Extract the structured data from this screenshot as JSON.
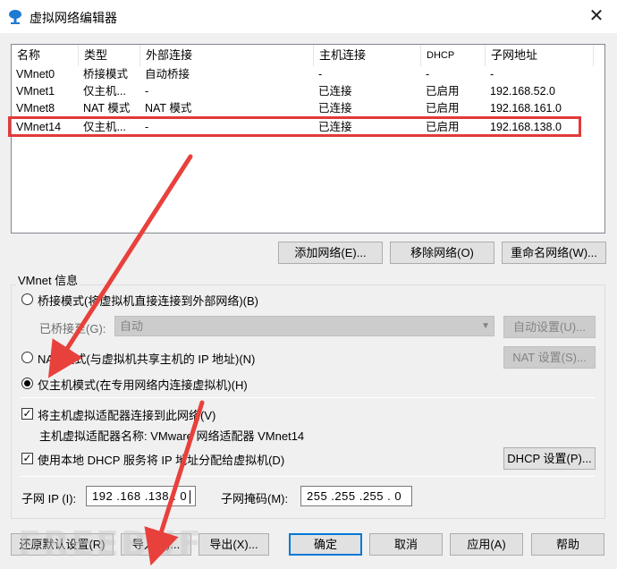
{
  "window": {
    "title": "虚拟网络编辑器",
    "close_glyph": "✕"
  },
  "network_list": {
    "columns": [
      "名称",
      "类型",
      "外部连接",
      "主机连接",
      "DHCP",
      "子网地址"
    ],
    "rows": [
      {
        "name": "VMnet0",
        "type": "桥接模式",
        "external": "自动桥接",
        "host": "-",
        "dhcp": "-",
        "subnet": "-"
      },
      {
        "name": "VMnet1",
        "type": "仅主机...",
        "external": "-",
        "host": "已连接",
        "dhcp": "已启用",
        "subnet": "192.168.52.0"
      },
      {
        "name": "VMnet8",
        "type": "NAT 模式",
        "external": "NAT 模式",
        "host": "已连接",
        "dhcp": "已启用",
        "subnet": "192.168.161.0"
      },
      {
        "name": "VMnet14",
        "type": "仅主机...",
        "external": "-",
        "host": "已连接",
        "dhcp": "已启用",
        "subnet": "192.168.138.0"
      }
    ],
    "selected_row": 3
  },
  "list_buttons": {
    "add": "添加网络(E)...",
    "remove": "移除网络(O)",
    "rename": "重命名网络(W)..."
  },
  "vmnet_info": {
    "group_label": "VMnet 信息",
    "bridged_radio": "桥接模式(将虚拟机直接连接到外部网络)(B)",
    "bridged_to_label": "已桥接至(G):",
    "bridged_to_value": "自动",
    "auto_settings": "自动设置(U)...",
    "nat_radio": "NAT 模式(与虚拟机共享主机的 IP 地址)(N)",
    "nat_settings": "NAT 设置(S)...",
    "hostonly_radio": "仅主机模式(在专用网络内连接虚拟机)(H)",
    "selected_mode": "hostonly",
    "connect_adapter_check": "将主机虚拟适配器连接到此网络(V)",
    "connect_adapter_checked": true,
    "adapter_name_label": "主机虚拟适配器名称: VMware 网络适配器 VMnet14",
    "dhcp_check": "使用本地 DHCP 服务将 IP 地址分配给虚拟机(D)",
    "dhcp_checked": true,
    "dhcp_settings": "DHCP 设置(P)...",
    "subnet_ip_label": "子网 IP (I):",
    "subnet_ip_value": "192 .168 .138 .  0",
    "subnet_mask_label": "子网掩码(M):",
    "subnet_mask_value": "255 .255 .255 .  0"
  },
  "footer_buttons": {
    "restore": "还原默认设置(R)",
    "import": "导入(T)...",
    "export": "导出(X)...",
    "ok": "确定",
    "cancel": "取消",
    "apply": "应用(A)",
    "help": "帮助"
  },
  "watermark": "FREEBUF",
  "colors": {
    "highlight_box": "#e23a3a",
    "arrow": "#e8413c",
    "dialog_bg": "#f0f0f0",
    "default_button_border": "#0078d7"
  }
}
